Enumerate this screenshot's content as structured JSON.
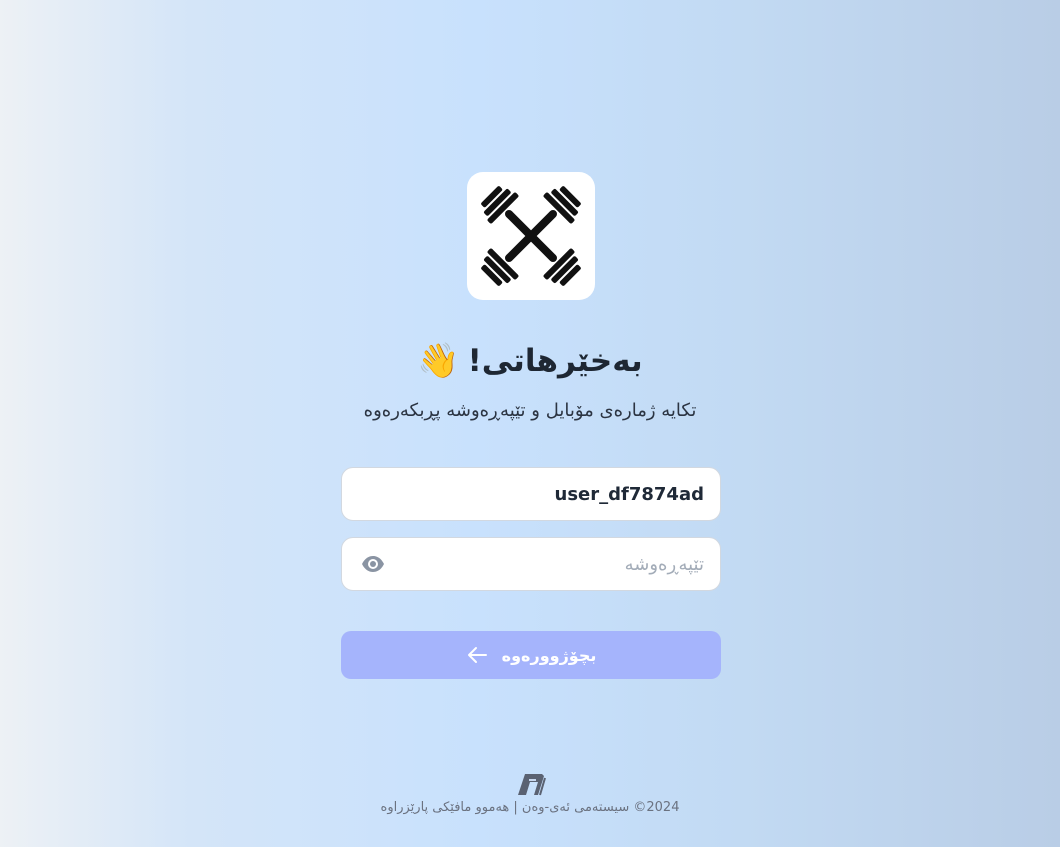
{
  "header": {
    "title": "بەخێرهاتی!",
    "wave_emoji": "👋",
    "subtitle": "تکایە ژمارەی مۆبایل و تێپەڕەوشە پڕبکەرەوە"
  },
  "form": {
    "username_value": "user_df7874ad",
    "password_placeholder": "تێپەڕەوشە",
    "submit_label": "بچۆژوورەوە"
  },
  "icons": {
    "logo": "crossed-dumbbells-icon",
    "password_toggle": "eye-icon",
    "submit_arrow": "arrow-left-icon",
    "footer_logo": "brand-mark-icon"
  },
  "footer": {
    "copyright": "2024© سیستەمی ئەی-وەن | هەموو مافێکی پارێزراوە"
  },
  "colors": {
    "button": "#a5b4fc",
    "text_dark": "#1e2733",
    "muted": "#6b7280"
  }
}
